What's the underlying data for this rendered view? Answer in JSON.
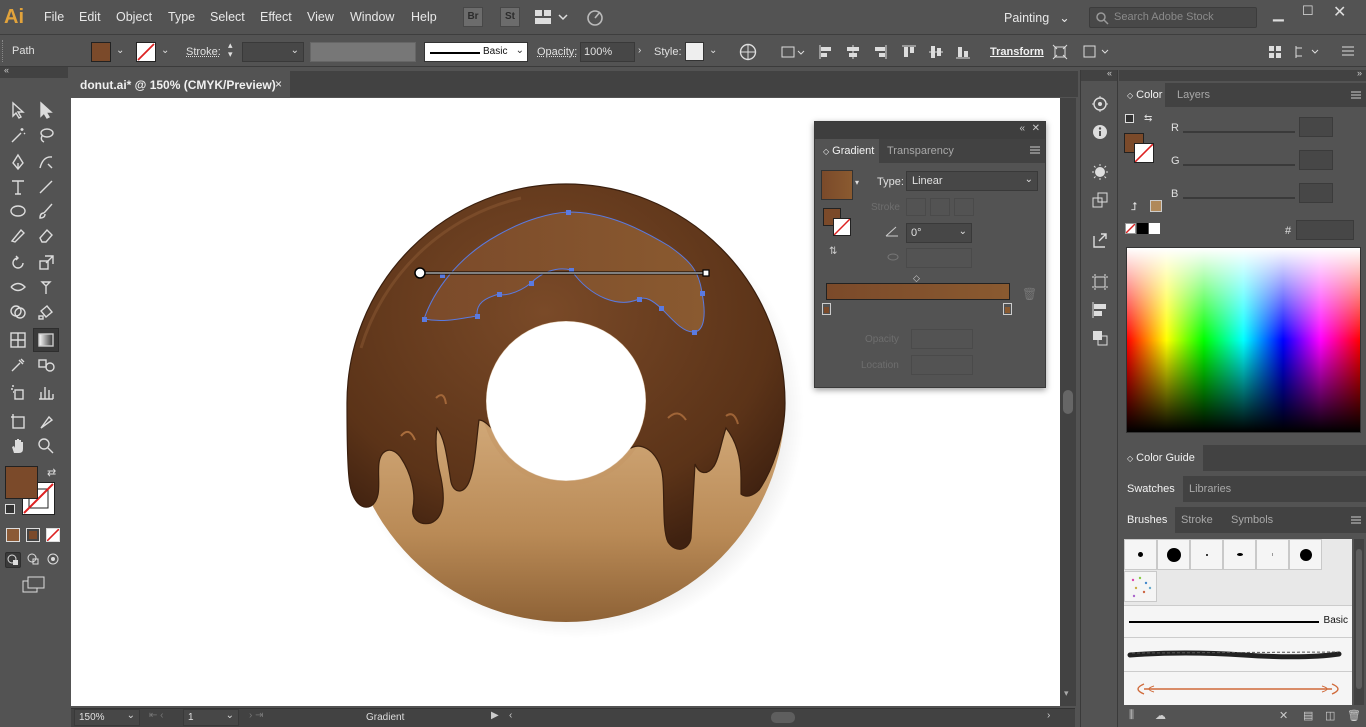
{
  "app": {
    "logo_text": "Ai",
    "accent": "#e2a33b"
  },
  "menu": {
    "items": [
      "File",
      "Edit",
      "Object",
      "Type",
      "Select",
      "Effect",
      "View",
      "Window",
      "Help"
    ]
  },
  "menubar_icons": {
    "bridge": "Br",
    "stock": "St"
  },
  "workspace": {
    "label": "Painting"
  },
  "search": {
    "placeholder": "Search Adobe Stock"
  },
  "control": {
    "selection_label": "Path",
    "fill_color": "#7b4a2a",
    "stroke_label": "Stroke:",
    "brush_label": "Basic",
    "opacity_label": "Opacity:",
    "opacity_value": "100%",
    "style_label": "Style:",
    "transform_label": "Transform"
  },
  "document": {
    "tab_title": "donut.ai* @ 150% (CMYK/Preview)",
    "close_glyph": "×"
  },
  "gradient_panel": {
    "tabs": [
      "Gradient",
      "Transparency"
    ],
    "type_label": "Type:",
    "type_value": "Linear",
    "stroke_label": "Stroke",
    "angle_value": "0°",
    "opacity_label": "Opacity",
    "location_label": "Location",
    "gradient_start": "#7b4a2a",
    "gradient_end": "#8a5a30"
  },
  "color_panel": {
    "tabs": [
      "Color",
      "Layers"
    ],
    "channels": [
      "R",
      "G",
      "B"
    ],
    "hex_label": "#"
  },
  "color_guide": {
    "label": "Color Guide"
  },
  "swatches_panel": {
    "tabs": [
      "Swatches",
      "Libraries"
    ]
  },
  "brushes_panel": {
    "tabs": [
      "Brushes",
      "Stroke",
      "Symbols"
    ],
    "basic_label": "Basic"
  },
  "status": {
    "zoom": "150%",
    "artboard": "1",
    "tool": "Gradient"
  }
}
